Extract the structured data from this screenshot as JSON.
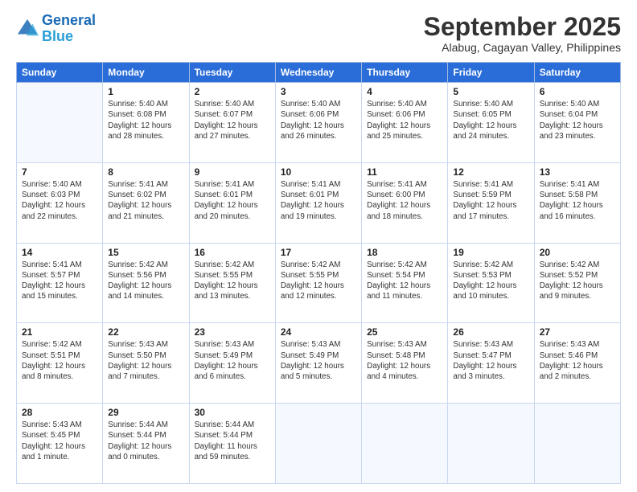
{
  "logo": {
    "line1": "General",
    "line2": "Blue"
  },
  "title": "September 2025",
  "subtitle": "Alabug, Cagayan Valley, Philippines",
  "headers": [
    "Sunday",
    "Monday",
    "Tuesday",
    "Wednesday",
    "Thursday",
    "Friday",
    "Saturday"
  ],
  "weeks": [
    [
      {
        "num": "",
        "detail": ""
      },
      {
        "num": "1",
        "detail": "Sunrise: 5:40 AM\nSunset: 6:08 PM\nDaylight: 12 hours\nand 28 minutes."
      },
      {
        "num": "2",
        "detail": "Sunrise: 5:40 AM\nSunset: 6:07 PM\nDaylight: 12 hours\nand 27 minutes."
      },
      {
        "num": "3",
        "detail": "Sunrise: 5:40 AM\nSunset: 6:06 PM\nDaylight: 12 hours\nand 26 minutes."
      },
      {
        "num": "4",
        "detail": "Sunrise: 5:40 AM\nSunset: 6:06 PM\nDaylight: 12 hours\nand 25 minutes."
      },
      {
        "num": "5",
        "detail": "Sunrise: 5:40 AM\nSunset: 6:05 PM\nDaylight: 12 hours\nand 24 minutes."
      },
      {
        "num": "6",
        "detail": "Sunrise: 5:40 AM\nSunset: 6:04 PM\nDaylight: 12 hours\nand 23 minutes."
      }
    ],
    [
      {
        "num": "7",
        "detail": "Sunrise: 5:40 AM\nSunset: 6:03 PM\nDaylight: 12 hours\nand 22 minutes."
      },
      {
        "num": "8",
        "detail": "Sunrise: 5:41 AM\nSunset: 6:02 PM\nDaylight: 12 hours\nand 21 minutes."
      },
      {
        "num": "9",
        "detail": "Sunrise: 5:41 AM\nSunset: 6:01 PM\nDaylight: 12 hours\nand 20 minutes."
      },
      {
        "num": "10",
        "detail": "Sunrise: 5:41 AM\nSunset: 6:01 PM\nDaylight: 12 hours\nand 19 minutes."
      },
      {
        "num": "11",
        "detail": "Sunrise: 5:41 AM\nSunset: 6:00 PM\nDaylight: 12 hours\nand 18 minutes."
      },
      {
        "num": "12",
        "detail": "Sunrise: 5:41 AM\nSunset: 5:59 PM\nDaylight: 12 hours\nand 17 minutes."
      },
      {
        "num": "13",
        "detail": "Sunrise: 5:41 AM\nSunset: 5:58 PM\nDaylight: 12 hours\nand 16 minutes."
      }
    ],
    [
      {
        "num": "14",
        "detail": "Sunrise: 5:41 AM\nSunset: 5:57 PM\nDaylight: 12 hours\nand 15 minutes."
      },
      {
        "num": "15",
        "detail": "Sunrise: 5:42 AM\nSunset: 5:56 PM\nDaylight: 12 hours\nand 14 minutes."
      },
      {
        "num": "16",
        "detail": "Sunrise: 5:42 AM\nSunset: 5:55 PM\nDaylight: 12 hours\nand 13 minutes."
      },
      {
        "num": "17",
        "detail": "Sunrise: 5:42 AM\nSunset: 5:55 PM\nDaylight: 12 hours\nand 12 minutes."
      },
      {
        "num": "18",
        "detail": "Sunrise: 5:42 AM\nSunset: 5:54 PM\nDaylight: 12 hours\nand 11 minutes."
      },
      {
        "num": "19",
        "detail": "Sunrise: 5:42 AM\nSunset: 5:53 PM\nDaylight: 12 hours\nand 10 minutes."
      },
      {
        "num": "20",
        "detail": "Sunrise: 5:42 AM\nSunset: 5:52 PM\nDaylight: 12 hours\nand 9 minutes."
      }
    ],
    [
      {
        "num": "21",
        "detail": "Sunrise: 5:42 AM\nSunset: 5:51 PM\nDaylight: 12 hours\nand 8 minutes."
      },
      {
        "num": "22",
        "detail": "Sunrise: 5:43 AM\nSunset: 5:50 PM\nDaylight: 12 hours\nand 7 minutes."
      },
      {
        "num": "23",
        "detail": "Sunrise: 5:43 AM\nSunset: 5:49 PM\nDaylight: 12 hours\nand 6 minutes."
      },
      {
        "num": "24",
        "detail": "Sunrise: 5:43 AM\nSunset: 5:49 PM\nDaylight: 12 hours\nand 5 minutes."
      },
      {
        "num": "25",
        "detail": "Sunrise: 5:43 AM\nSunset: 5:48 PM\nDaylight: 12 hours\nand 4 minutes."
      },
      {
        "num": "26",
        "detail": "Sunrise: 5:43 AM\nSunset: 5:47 PM\nDaylight: 12 hours\nand 3 minutes."
      },
      {
        "num": "27",
        "detail": "Sunrise: 5:43 AM\nSunset: 5:46 PM\nDaylight: 12 hours\nand 2 minutes."
      }
    ],
    [
      {
        "num": "28",
        "detail": "Sunrise: 5:43 AM\nSunset: 5:45 PM\nDaylight: 12 hours\nand 1 minute."
      },
      {
        "num": "29",
        "detail": "Sunrise: 5:44 AM\nSunset: 5:44 PM\nDaylight: 12 hours\nand 0 minutes."
      },
      {
        "num": "30",
        "detail": "Sunrise: 5:44 AM\nSunset: 5:44 PM\nDaylight: 11 hours\nand 59 minutes."
      },
      {
        "num": "",
        "detail": ""
      },
      {
        "num": "",
        "detail": ""
      },
      {
        "num": "",
        "detail": ""
      },
      {
        "num": "",
        "detail": ""
      }
    ]
  ]
}
